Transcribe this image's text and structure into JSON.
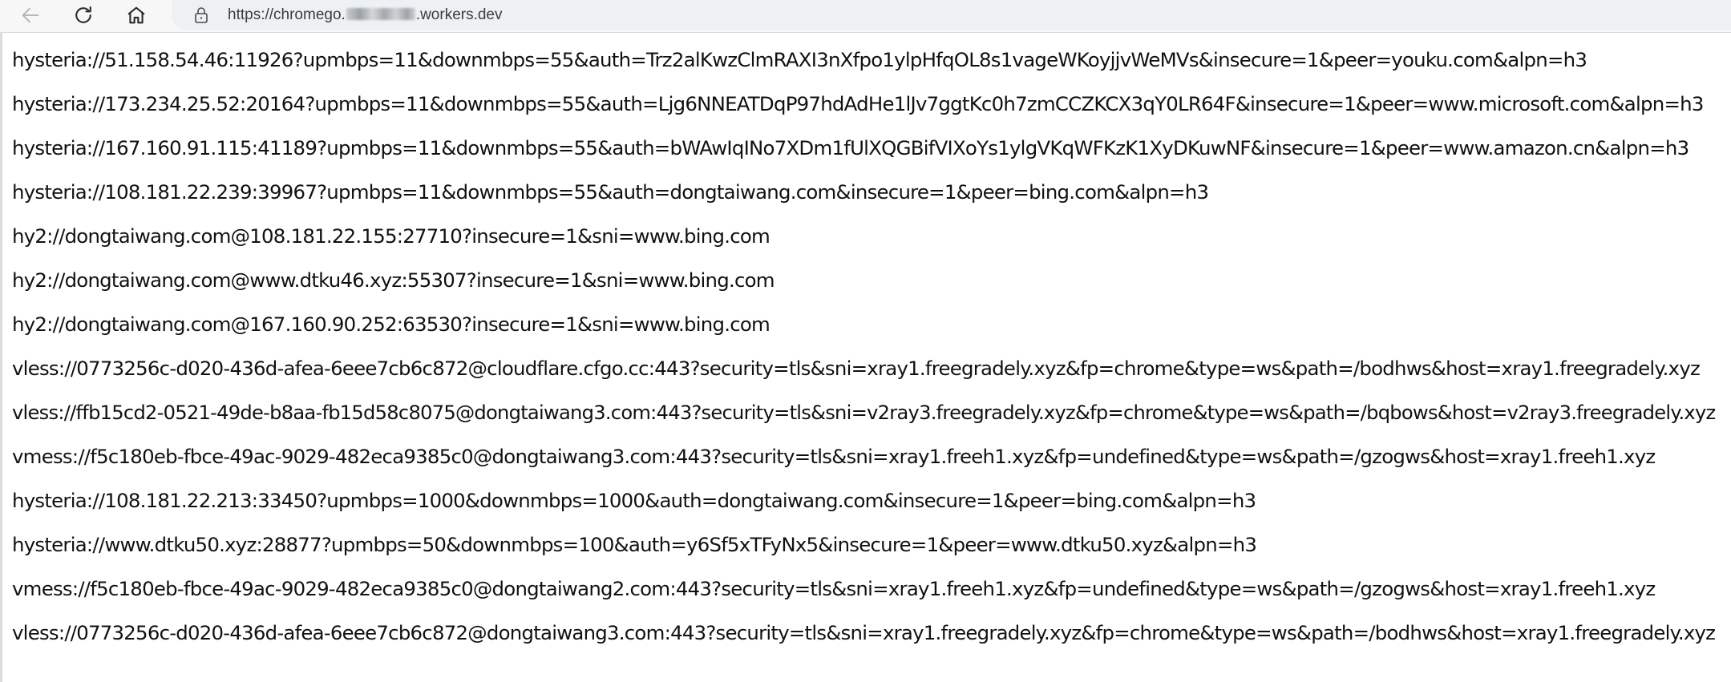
{
  "browser": {
    "url_prefix": "https://chromego.",
    "url_suffix": ".workers.dev",
    "icons": {
      "back": "back-arrow-icon",
      "reload": "reload-icon",
      "home": "home-icon",
      "security": "lock-icon"
    }
  },
  "page": {
    "lines": [
      "hysteria://51.158.54.46:11926?upmbps=11&downmbps=55&auth=Trz2alKwzClmRAXI3nXfpo1ylpHfqOL8s1vageWKoyjjvWeMVs&insecure=1&peer=youku.com&alpn=h3",
      "hysteria://173.234.25.52:20164?upmbps=11&downmbps=55&auth=Ljg6NNEATDqP97hdAdHe1lJv7ggtKc0h7zmCCZKCX3qY0LR64F&insecure=1&peer=www.microsoft.com&alpn=h3",
      "hysteria://167.160.91.115:41189?upmbps=11&downmbps=55&auth=bWAwIqINo7XDm1fUlXQGBifVIXoYs1ylgVKqWFKzK1XyDKuwNF&insecure=1&peer=www.amazon.cn&alpn=h3",
      "hysteria://108.181.22.239:39967?upmbps=11&downmbps=55&auth=dongtaiwang.com&insecure=1&peer=bing.com&alpn=h3",
      "hy2://dongtaiwang.com@108.181.22.155:27710?insecure=1&sni=www.bing.com",
      "hy2://dongtaiwang.com@www.dtku46.xyz:55307?insecure=1&sni=www.bing.com",
      "hy2://dongtaiwang.com@167.160.90.252:63530?insecure=1&sni=www.bing.com",
      "vless://0773256c-d020-436d-afea-6eee7cb6c872@cloudflare.cfgo.cc:443?security=tls&sni=xray1.freegradely.xyz&fp=chrome&type=ws&path=/bodhws&host=xray1.freegradely.xyz",
      "vless://ffb15cd2-0521-49de-b8aa-fb15d58c8075@dongtaiwang3.com:443?security=tls&sni=v2ray3.freegradely.xyz&fp=chrome&type=ws&path=/bqbows&host=v2ray3.freegradely.xyz",
      "vmess://f5c180eb-fbce-49ac-9029-482eca9385c0@dongtaiwang3.com:443?security=tls&sni=xray1.freeh1.xyz&fp=undefined&type=ws&path=/gzogws&host=xray1.freeh1.xyz",
      "hysteria://108.181.22.213:33450?upmbps=1000&downmbps=1000&auth=dongtaiwang.com&insecure=1&peer=bing.com&alpn=h3",
      "hysteria://www.dtku50.xyz:28877?upmbps=50&downmbps=100&auth=y6Sf5xTFyNx5&insecure=1&peer=www.dtku50.xyz&alpn=h3",
      "vmess://f5c180eb-fbce-49ac-9029-482eca9385c0@dongtaiwang2.com:443?security=tls&sni=xray1.freeh1.xyz&fp=undefined&type=ws&path=/gzogws&host=xray1.freeh1.xyz",
      "vless://0773256c-d020-436d-afea-6eee7cb6c872@dongtaiwang3.com:443?security=tls&sni=xray1.freegradely.xyz&fp=chrome&type=ws&path=/bodhws&host=xray1.freegradely.xyz"
    ]
  }
}
